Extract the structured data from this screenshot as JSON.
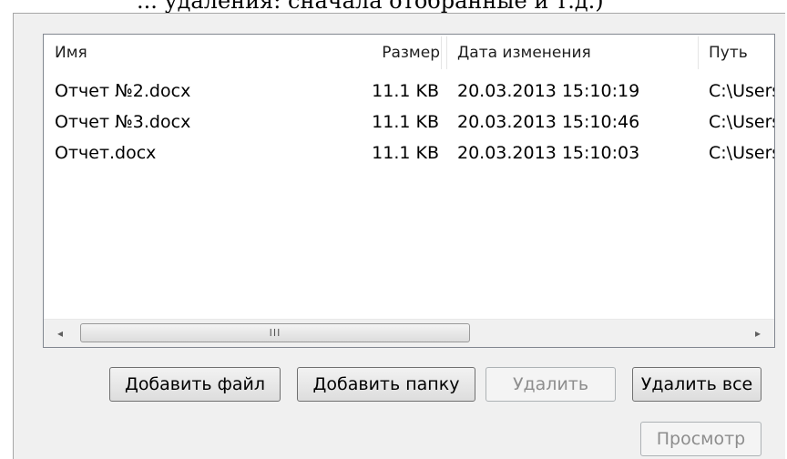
{
  "top_caption": "... удаления: сначала отобранные и т.д.)",
  "columns": {
    "name": "Имя",
    "size": "Размер",
    "date": "Дата изменения",
    "path": "Путь"
  },
  "files": [
    {
      "name": "Отчет №2.docx",
      "size": "11.1 KB",
      "date": "20.03.2013 15:10:19",
      "path": "C:\\Users"
    },
    {
      "name": "Отчет №3.docx",
      "size": "11.1 KB",
      "date": "20.03.2013 15:10:46",
      "path": "C:\\Users"
    },
    {
      "name": "Отчет.docx",
      "size": "11.1 KB",
      "date": "20.03.2013 15:10:03",
      "path": "C:\\Users"
    }
  ],
  "scrollbar": {
    "left_arrow": "◂",
    "right_arrow": "▸",
    "thumb_grip": "III"
  },
  "buttons": {
    "add_file": "Добавить файл",
    "add_folder": "Добавить папку",
    "delete": "Удалить",
    "delete_all": "Удалить все",
    "preview": "Просмотр"
  }
}
